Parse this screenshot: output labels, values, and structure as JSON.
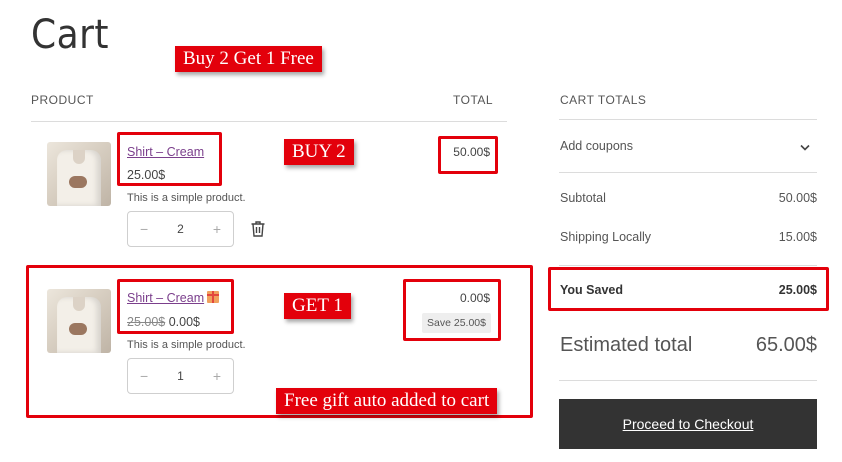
{
  "page": {
    "title": "Cart"
  },
  "callouts": {
    "promo": "Buy 2 Get 1 Free",
    "buy": "BUY 2",
    "get": "GET 1",
    "auto": "Free gift auto added to cart"
  },
  "table": {
    "col_product": "PRODUCT",
    "col_total": "TOTAL"
  },
  "items": [
    {
      "name": "Shirt – Cream",
      "price": "25.00$",
      "description": "This is a simple product.",
      "qty": "2",
      "qty_minus": "−",
      "qty_plus": "+",
      "total": "50.00$"
    },
    {
      "name": "Shirt – Cream",
      "original_price": "25.00$",
      "price": "0.00$",
      "description": "This is a simple product.",
      "qty": "1",
      "qty_minus": "−",
      "qty_plus": "+",
      "total": "0.00$",
      "save_badge": "Save 25.00$"
    }
  ],
  "totals": {
    "heading": "CART TOTALS",
    "coupons_label": "Add coupons",
    "subtotal_label": "Subtotal",
    "subtotal_value": "50.00$",
    "shipping_label": "Shipping Locally",
    "shipping_value": "15.00$",
    "saved_label": "You Saved",
    "saved_value": "25.00$",
    "estimated_label": "Estimated total",
    "estimated_value": "65.00$",
    "checkout_label": "Proceed to Checkout"
  },
  "colors": {
    "highlight": "#e3000b",
    "link": "#7b3f8c",
    "button": "#333333"
  },
  "icons": {
    "trash": "trash-icon",
    "chevron": "chevron-down-icon",
    "gift": "gift-icon"
  }
}
